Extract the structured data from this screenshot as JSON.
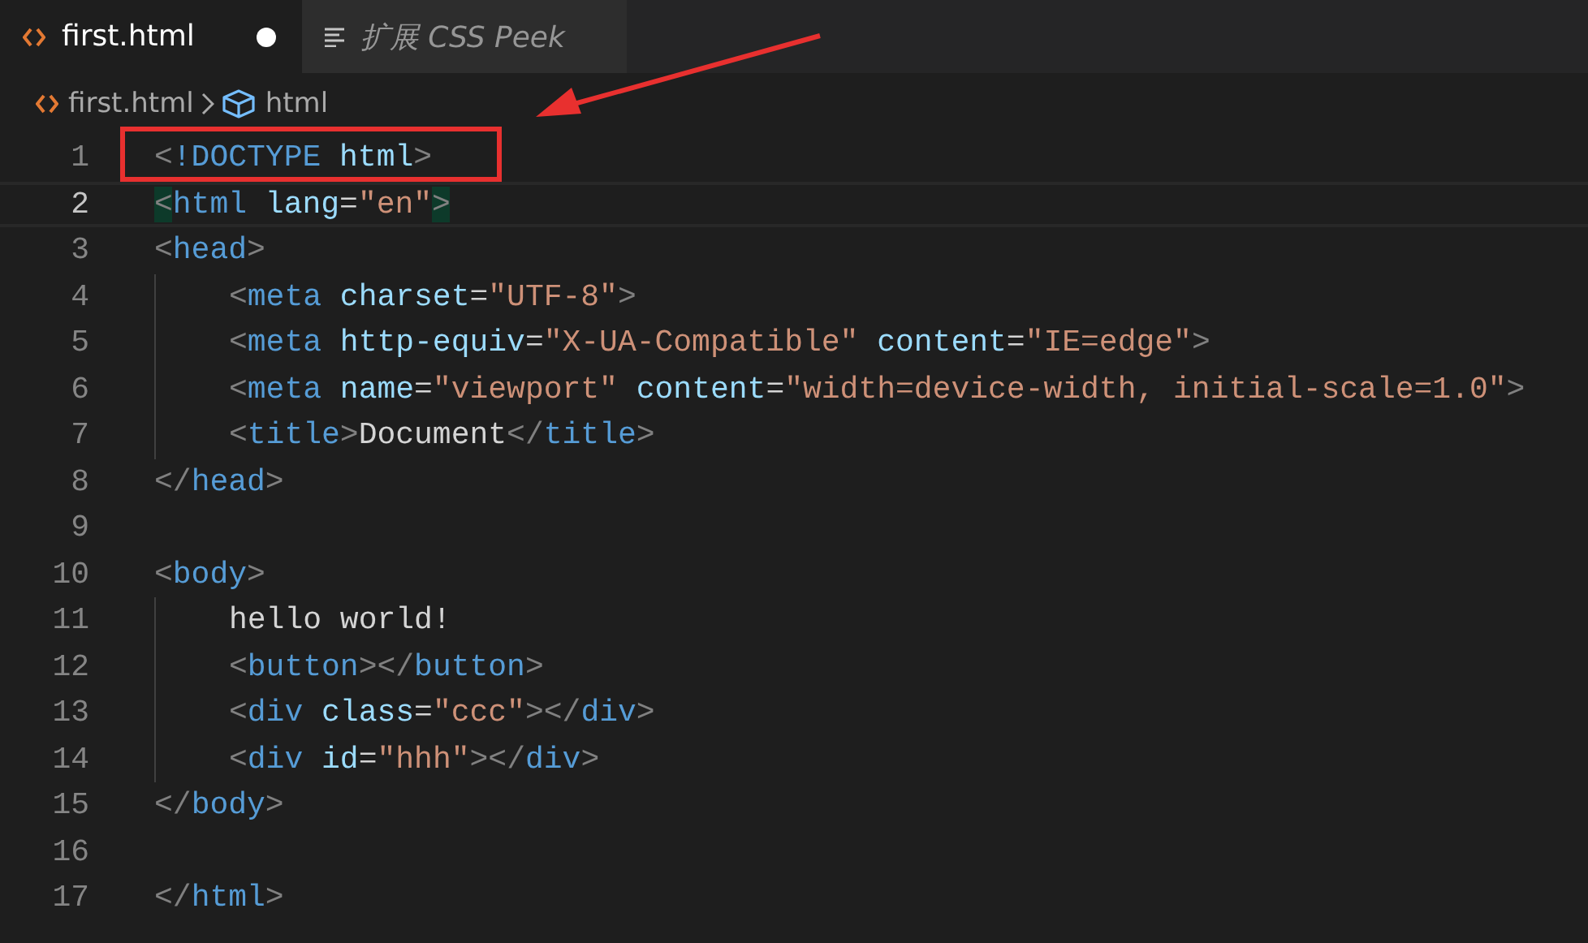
{
  "tabs": [
    {
      "kind": "file",
      "label": "first.html",
      "selected": true,
      "modified": true
    },
    {
      "kind": "preview",
      "label": "扩展 CSS Peek",
      "selected": false,
      "modified": false
    }
  ],
  "breadcrumbs": [
    {
      "kind": "file",
      "label": "first.html"
    },
    {
      "kind": "element",
      "label": "html"
    }
  ],
  "lines": [
    {
      "number": "1",
      "current": false,
      "tokens": [
        {
          "kind": "punct",
          "text": "<"
        },
        {
          "kind": "tag",
          "text": "!DOCTYPE"
        },
        {
          "kind": "attr",
          "text": " html"
        },
        {
          "kind": "punct",
          "text": ">"
        }
      ]
    },
    {
      "number": "2",
      "current": true,
      "tokens": [
        {
          "kind": "punct",
          "text": "<"
        },
        {
          "kind": "tag",
          "text": "html"
        },
        {
          "kind": "attr",
          "text": " lang"
        },
        {
          "kind": "text",
          "text": "="
        },
        {
          "kind": "string",
          "text": "\"en\""
        },
        {
          "kind": "punct",
          "text": ">"
        }
      ]
    },
    {
      "number": "3",
      "current": false,
      "tokens": [
        {
          "kind": "punct",
          "text": "<"
        },
        {
          "kind": "tag",
          "text": "head"
        },
        {
          "kind": "punct",
          "text": ">"
        }
      ],
      "children": [
        {
          "number": "4",
          "current": false,
          "tokens": [
            {
              "kind": "punct",
              "text": "<"
            },
            {
              "kind": "tag",
              "text": "meta"
            },
            {
              "kind": "attr",
              "text": " charset"
            },
            {
              "kind": "text",
              "text": "="
            },
            {
              "kind": "string",
              "text": "\"UTF-8\""
            },
            {
              "kind": "punct",
              "text": ">"
            }
          ]
        },
        {
          "number": "5",
          "current": false,
          "tokens": [
            {
              "kind": "punct",
              "text": "<"
            },
            {
              "kind": "tag",
              "text": "meta"
            },
            {
              "kind": "attr",
              "text": " http-equiv"
            },
            {
              "kind": "text",
              "text": "="
            },
            {
              "kind": "string",
              "text": "\"X-UA-Compatible\""
            },
            {
              "kind": "attr",
              "text": " content"
            },
            {
              "kind": "text",
              "text": "="
            },
            {
              "kind": "string",
              "text": "\"IE=edge\""
            },
            {
              "kind": "punct",
              "text": ">"
            }
          ]
        },
        {
          "number": "6",
          "current": false,
          "tokens": [
            {
              "kind": "punct",
              "text": "<"
            },
            {
              "kind": "tag",
              "text": "meta"
            },
            {
              "kind": "attr",
              "text": " name"
            },
            {
              "kind": "text",
              "text": "="
            },
            {
              "kind": "string",
              "text": "\"viewport\""
            },
            {
              "kind": "attr",
              "text": " content"
            },
            {
              "kind": "text",
              "text": "="
            },
            {
              "kind": "string",
              "text": "\"width=device-width, initial-scale=1.0\""
            },
            {
              "kind": "punct",
              "text": ">"
            }
          ]
        },
        {
          "number": "7",
          "current": false,
          "tokens": [
            {
              "kind": "punct",
              "text": "<"
            },
            {
              "kind": "tag",
              "text": "title"
            },
            {
              "kind": "punct",
              "text": ">"
            },
            {
              "kind": "text",
              "text": "Document"
            },
            {
              "kind": "punct",
              "text": "</"
            },
            {
              "kind": "tag",
              "text": "title"
            },
            {
              "kind": "punct",
              "text": ">"
            }
          ]
        }
      ]
    },
    {
      "number": "8",
      "current": false,
      "tokens": [
        {
          "kind": "punct",
          "text": "</"
        },
        {
          "kind": "tag",
          "text": "head"
        },
        {
          "kind": "punct",
          "text": ">"
        }
      ]
    },
    {
      "number": "9",
      "current": false
    },
    {
      "number": "10",
      "current": false,
      "tokens": [
        {
          "kind": "punct",
          "text": "<"
        },
        {
          "kind": "tag",
          "text": "body"
        },
        {
          "kind": "punct",
          "text": ">"
        }
      ],
      "children": [
        {
          "number": "11",
          "current": false,
          "tokens": [
            {
              "kind": "text",
              "text": "hello world!"
            }
          ]
        },
        {
          "number": "12",
          "current": false,
          "tokens": [
            {
              "kind": "punct",
              "text": "<"
            },
            {
              "kind": "tag",
              "text": "button"
            },
            {
              "kind": "punct",
              "text": "></"
            },
            {
              "kind": "tag",
              "text": "button"
            },
            {
              "kind": "punct",
              "text": ">"
            }
          ]
        },
        {
          "number": "13",
          "current": false,
          "tokens": [
            {
              "kind": "punct",
              "text": "<"
            },
            {
              "kind": "tag",
              "text": "div"
            },
            {
              "kind": "attr",
              "text": " class"
            },
            {
              "kind": "text",
              "text": "="
            },
            {
              "kind": "string",
              "text": "\"ccc\""
            },
            {
              "kind": "punct",
              "text": "></"
            },
            {
              "kind": "tag",
              "text": "div"
            },
            {
              "kind": "punct",
              "text": ">"
            }
          ]
        },
        {
          "number": "14",
          "current": false,
          "tokens": [
            {
              "kind": "punct",
              "text": "<"
            },
            {
              "kind": "tag",
              "text": "div"
            },
            {
              "kind": "attr",
              "text": " id"
            },
            {
              "kind": "text",
              "text": "="
            },
            {
              "kind": "string",
              "text": "\"hhh\""
            },
            {
              "kind": "punct",
              "text": "></"
            },
            {
              "kind": "tag",
              "text": "div"
            },
            {
              "kind": "punct",
              "text": ">"
            }
          ]
        }
      ]
    },
    {
      "number": "15",
      "current": false,
      "tokens": [
        {
          "kind": "punct",
          "text": "</"
        },
        {
          "kind": "tag",
          "text": "body"
        },
        {
          "kind": "punct",
          "text": ">"
        }
      ]
    },
    {
      "number": "16",
      "current": false
    },
    {
      "number": "17",
      "current": false,
      "tokens": [
        {
          "kind": "punct",
          "text": "</"
        },
        {
          "kind": "tag",
          "text": "html"
        },
        {
          "kind": "punct",
          "text": ">"
        }
      ]
    }
  ]
}
